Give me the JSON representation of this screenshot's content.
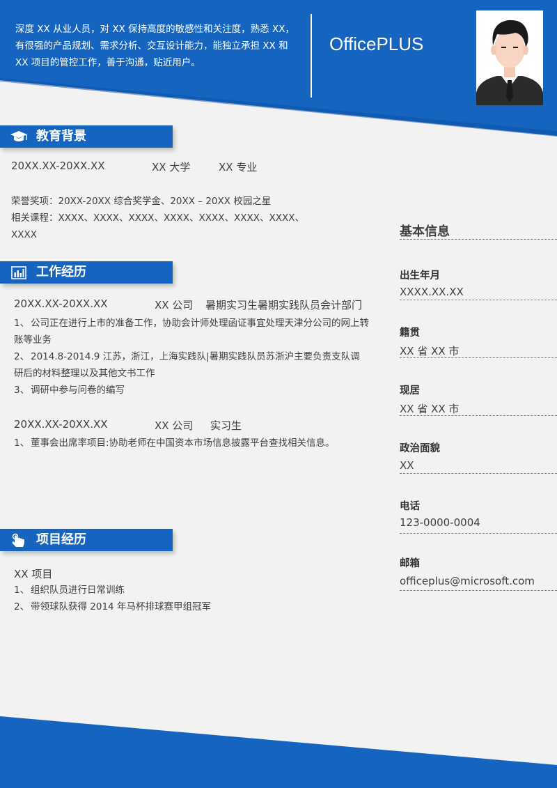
{
  "header": {
    "intro": "深度 XX 从业人员，对 XX 保持高度的敏感性和关注度，熟悉 XX，有很强的产品规划、需求分析、交互设计能力，能独立承担 XX 和 XX 项目的管控工作，善于沟通，贴近用户。",
    "brand": "OfficePLUS"
  },
  "education": {
    "title": "教育背景",
    "date": "20XX.XX-20XX.XX",
    "school": "XX 大学",
    "major": "XX 专业",
    "honors": "荣誉奖项：20XX-20XX  综合奖学金、20XX  –  20XX 校园之星",
    "courses": "相关课程：XXXX、XXXX、XXXX、XXXX、XXXX、XXXX、XXXX、XXXX"
  },
  "work": {
    "title": "工作经历",
    "jobs": [
      {
        "date": "20XX.XX-20XX.XX",
        "company": "XX 公司",
        "role": "暑期实习生暑期实践队员会计部门",
        "items": [
          {
            "num": "1、",
            "text": "公司正在进行上市的准备工作，协助会计师处理函证事宜处理天津分公司的网上转账等业务"
          },
          {
            "num": "2、",
            "text": "2014.8-2014.9 江苏，浙江，上海实践队|暑期实践队员苏浙沪主要负责支队调研后的材料整理以及其他文书工作"
          },
          {
            "num": "3、",
            "text": "调研中参与问卷的编写"
          }
        ]
      },
      {
        "date": "20XX.XX-20XX.XX",
        "company": "XX 公司",
        "role": "实习生",
        "items": [
          {
            "num": "1、",
            "text": "董事会出席率项目:协助老师在中国资本市场信息披露平台查找相关信息。"
          }
        ]
      }
    ]
  },
  "project": {
    "title": "项目经历",
    "name": "XX 项目",
    "items": [
      {
        "num": "1、",
        "text": "组织队员进行日常训练"
      },
      {
        "num": "2、",
        "text": "带领球队获得 2014 年马杯排球赛甲组冠军"
      }
    ]
  },
  "basic": {
    "title": "基本信息",
    "fields": [
      {
        "label": "出生年月",
        "value": "XXXX.XX.XX"
      },
      {
        "label": "籍贯",
        "value": "XX 省 XX 市"
      },
      {
        "label": "现居",
        "value": "XX 省 XX 市"
      },
      {
        "label": "政治面貌",
        "value": "XX"
      },
      {
        "label": "电话",
        "value": "123-0000-0004"
      },
      {
        "label": "邮箱",
        "value": "officeplus@microsoft.com"
      }
    ]
  },
  "colors": {
    "accent": "#1565c0",
    "background": "#f2f2f2"
  }
}
